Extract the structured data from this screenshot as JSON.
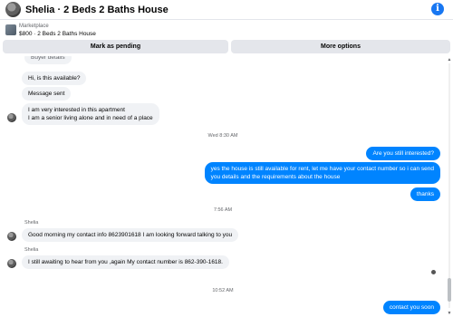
{
  "header": {
    "title": "Shelia · 2 Beds 2 Baths House",
    "info_icon": "i"
  },
  "listing": {
    "category": "Marketplace",
    "price_title": "$800 · 2 Beds 2 Baths House"
  },
  "actions": {
    "pending_label": "Mark as pending",
    "more_label": "More options"
  },
  "colors": {
    "accent": "#1877f2",
    "outgoing": "#0084ff",
    "incoming": "#f0f2f5",
    "button": "#e4e6eb"
  },
  "messages": {
    "clipped": "Buyer details",
    "available": "Hi, is this available?",
    "sent": "Message sent",
    "interested_1": "I am very interested in this apartment",
    "interested_2": "I am a senior living alone and in need of a place",
    "ts1": "Wed 8:30 AM",
    "still_interested": "Are you still interested?",
    "reply_1": "yes the house is still available for rent, let me have your contact number so i can send",
    "reply_2": "you details and the requirements about the house",
    "thanks": "thanks",
    "ts2": "7:56 AM",
    "sender1": "Shelia",
    "contact_info": "Good morning my contact info 8623901618 I am looking forward talking to you",
    "sender2": "Shelia",
    "awaiting": "I still awaiting to hear from you ,again My contact number is 862-390-1618.",
    "ts3": "10:52 AM",
    "contact_soon": "contact you soon"
  },
  "icons": {
    "info": "info-icon",
    "scroll_up": "chevron-up-icon",
    "scroll_down": "chevron-down-icon"
  }
}
